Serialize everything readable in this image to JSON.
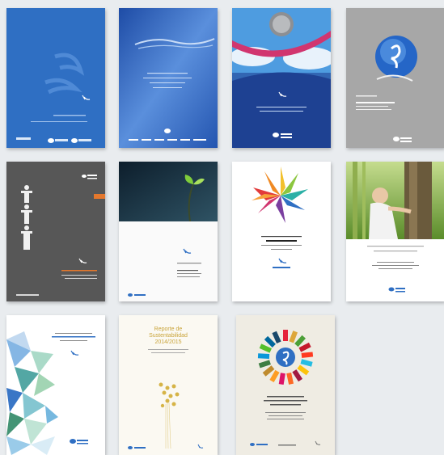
{
  "covers": [
    {
      "title": ""
    },
    {
      "title": ""
    },
    {
      "title": ""
    },
    {
      "title": ""
    },
    {
      "title": ""
    },
    {
      "title": ""
    },
    {
      "title": ""
    },
    {
      "title": ""
    },
    {
      "title": ""
    },
    {
      "title": "Reporte de Sustentabilidad 2014/2015"
    },
    {
      "title": ""
    }
  ],
  "colors": {
    "page_bg": "#e9ecef",
    "brand_blue": "#2f6fc3",
    "dark_grey": "#575757",
    "gold": "#c9a43a"
  }
}
